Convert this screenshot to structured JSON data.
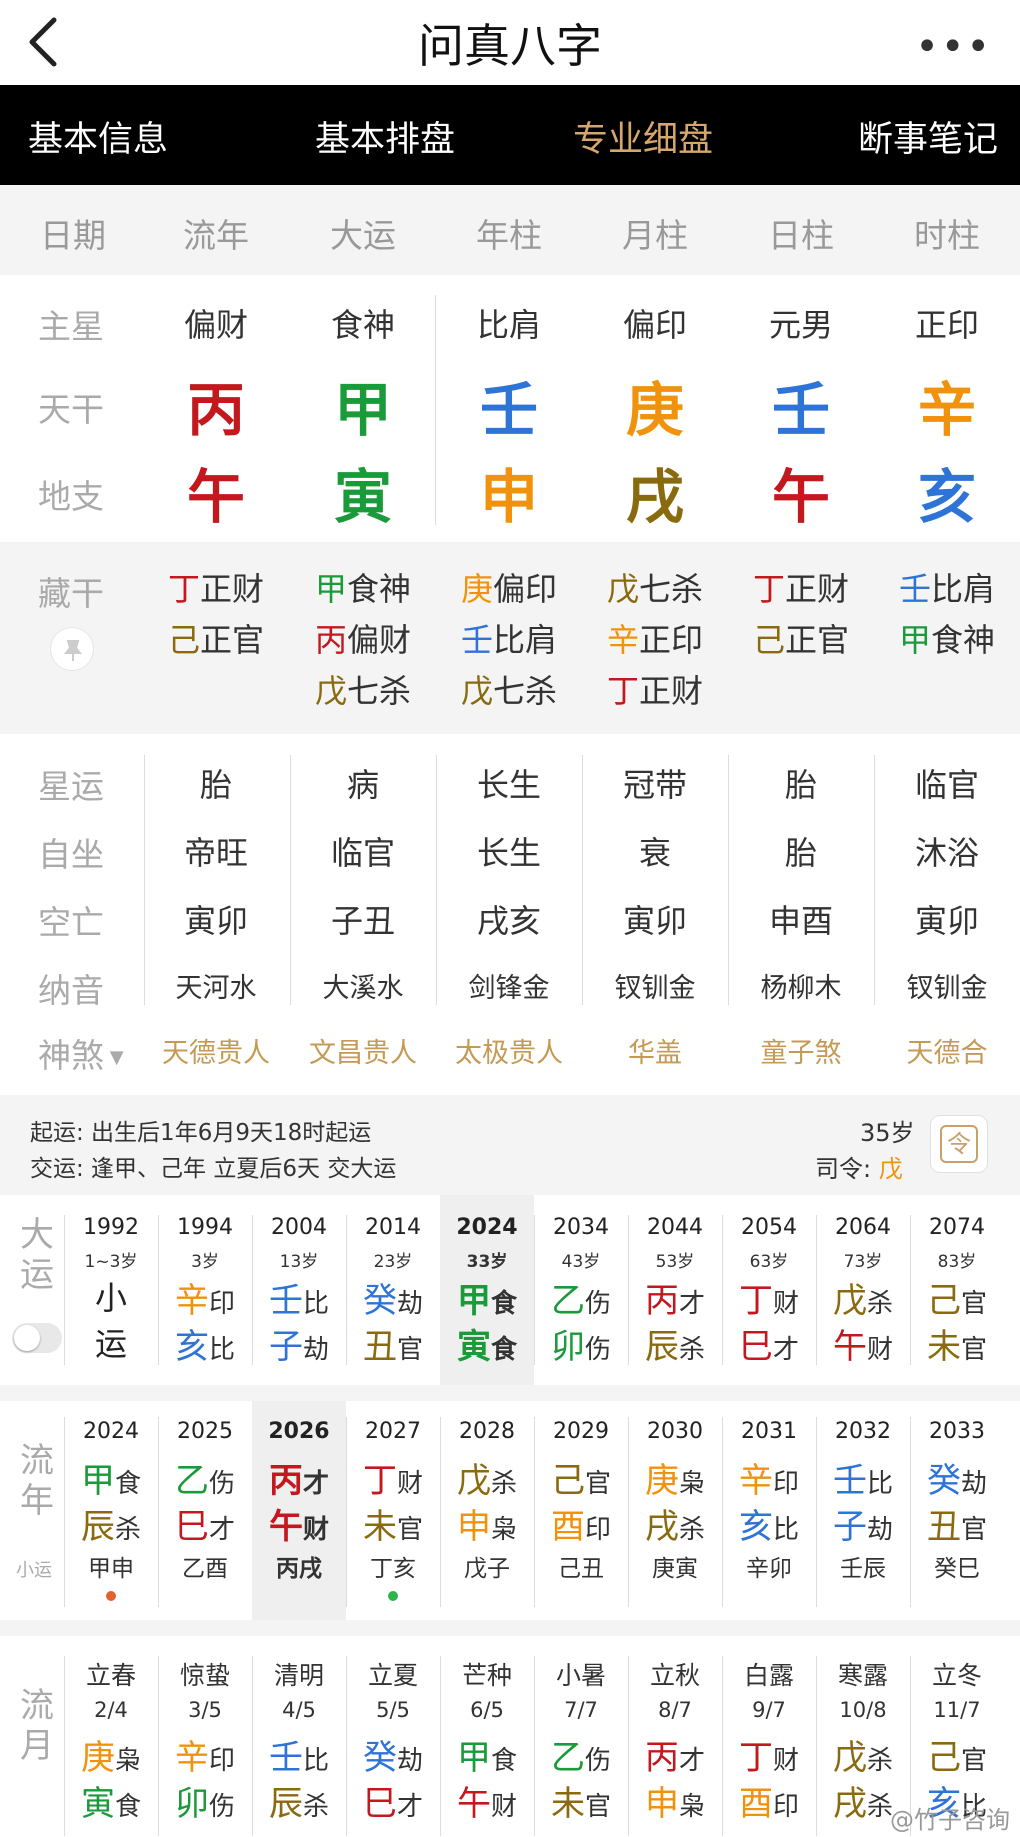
{
  "nav": {
    "title": "问真八字",
    "more": "•••"
  },
  "tabs": [
    "基本信息",
    "基本排盘",
    "专业细盘",
    "断事笔记"
  ],
  "columns": [
    "日期",
    "流年",
    "大运",
    "年柱",
    "月柱",
    "日柱",
    "时柱"
  ],
  "colors": {
    "fire": "#c3181e",
    "wood": "#1a9a38",
    "water": "#2e73d6",
    "metal": "#f0920c",
    "earth": "#8a6a0e",
    "accent": "#d6a76c"
  },
  "pillars": {
    "labels": {
      "main": "主星",
      "stem": "天干",
      "branch": "地支",
      "hidden": "藏干"
    },
    "main": [
      "偏财",
      "食神",
      "比肩",
      "偏印",
      "元男",
      "正印"
    ],
    "stems": [
      "丙",
      "甲",
      "壬",
      "庚",
      "壬",
      "辛"
    ],
    "branches": [
      "午",
      "寅",
      "申",
      "戌",
      "午",
      "亥"
    ],
    "hidden": [
      [
        [
          "丁",
          "正财"
        ],
        [
          "己",
          "正官"
        ]
      ],
      [
        [
          "甲",
          "食神"
        ],
        [
          "丙",
          "偏财"
        ],
        [
          "戊",
          "七杀"
        ]
      ],
      [
        [
          "庚",
          "偏印"
        ],
        [
          "壬",
          "比肩"
        ],
        [
          "戊",
          "七杀"
        ]
      ],
      [
        [
          "戊",
          "七杀"
        ],
        [
          "辛",
          "正印"
        ],
        [
          "丁",
          "正财"
        ]
      ],
      [
        [
          "丁",
          "正财"
        ],
        [
          "己",
          "正官"
        ]
      ],
      [
        [
          "壬",
          "比肩"
        ],
        [
          "甲",
          "食神"
        ]
      ]
    ]
  },
  "info": {
    "labels": {
      "xy": "星运",
      "zz": "自坐",
      "kw": "空亡",
      "ny": "纳音",
      "ss": "神煞"
    },
    "xingyun": [
      "胎",
      "病",
      "长生",
      "冠带",
      "胎",
      "临官"
    ],
    "zizuo": [
      "帝旺",
      "临官",
      "长生",
      "衰",
      "胎",
      "沐浴"
    ],
    "kongwang": [
      "寅卯",
      "子丑",
      "戌亥",
      "寅卯",
      "申酉",
      "寅卯"
    ],
    "nayin": [
      "天河水",
      "大溪水",
      "剑锋金",
      "钗钏金",
      "杨柳木",
      "钗钏金"
    ],
    "shensha": [
      "天德贵人",
      "文昌贵人",
      "太极贵人",
      "华盖",
      "童子煞",
      "天德合"
    ]
  },
  "luck": {
    "qiyun": "起运:  出生后1年6月9天18时起运",
    "jiaoyun": "交运:  逢甲、己年 立夏后6天 交大运",
    "age": "35岁",
    "siling": "司令:",
    "siling_val": "戊",
    "btn": "令"
  },
  "dayun": {
    "label1": "大",
    "label2": "运",
    "items": [
      {
        "year": "1992",
        "age": "1~3岁",
        "top": "小",
        "bot": "运"
      },
      {
        "year": "1994",
        "age": "3岁",
        "s": "辛",
        "sg": "印",
        "b": "亥",
        "bg": "比"
      },
      {
        "year": "2004",
        "age": "13岁",
        "s": "壬",
        "sg": "比",
        "b": "子",
        "bg": "劫"
      },
      {
        "year": "2014",
        "age": "23岁",
        "s": "癸",
        "sg": "劫",
        "b": "丑",
        "bg": "官"
      },
      {
        "year": "2024",
        "age": "33岁",
        "s": "甲",
        "sg": "食",
        "b": "寅",
        "bg": "食"
      },
      {
        "year": "2034",
        "age": "43岁",
        "s": "乙",
        "sg": "伤",
        "b": "卯",
        "bg": "伤"
      },
      {
        "year": "2044",
        "age": "53岁",
        "s": "丙",
        "sg": "才",
        "b": "辰",
        "bg": "杀"
      },
      {
        "year": "2054",
        "age": "63岁",
        "s": "丁",
        "sg": "财",
        "b": "巳",
        "bg": "才"
      },
      {
        "year": "2064",
        "age": "73岁",
        "s": "戊",
        "sg": "杀",
        "b": "午",
        "bg": "财"
      },
      {
        "year": "2074",
        "age": "83岁",
        "s": "己",
        "sg": "官",
        "b": "未",
        "bg": "官"
      }
    ]
  },
  "liunian": {
    "label1": "流",
    "label2": "年",
    "label3": "小运",
    "items": [
      {
        "year": "2024",
        "s": "甲",
        "sg": "食",
        "b": "辰",
        "bg": "杀",
        "x": "甲申"
      },
      {
        "year": "2025",
        "s": "乙",
        "sg": "伤",
        "b": "巳",
        "bg": "才",
        "x": "乙酉"
      },
      {
        "year": "2026",
        "s": "丙",
        "sg": "才",
        "b": "午",
        "bg": "财",
        "x": "丙戌"
      },
      {
        "year": "2027",
        "s": "丁",
        "sg": "财",
        "b": "未",
        "bg": "官",
        "x": "丁亥"
      },
      {
        "year": "2028",
        "s": "戊",
        "sg": "杀",
        "b": "申",
        "bg": "枭",
        "x": "戊子"
      },
      {
        "year": "2029",
        "s": "己",
        "sg": "官",
        "b": "酉",
        "bg": "印",
        "x": "己丑"
      },
      {
        "year": "2030",
        "s": "庚",
        "sg": "枭",
        "b": "戌",
        "bg": "杀",
        "x": "庚寅"
      },
      {
        "year": "2031",
        "s": "辛",
        "sg": "印",
        "b": "亥",
        "bg": "比",
        "x": "辛卯"
      },
      {
        "year": "2032",
        "s": "壬",
        "sg": "比",
        "b": "子",
        "bg": "劫",
        "x": "壬辰"
      },
      {
        "year": "2033",
        "s": "癸",
        "sg": "劫",
        "b": "丑",
        "bg": "官",
        "x": "癸巳"
      }
    ]
  },
  "liuyue": {
    "label1": "流",
    "label2": "月",
    "items": [
      {
        "term": "立春",
        "date": "2/4",
        "s": "庚",
        "sg": "枭",
        "b": "寅",
        "bg": "食"
      },
      {
        "term": "惊蛰",
        "date": "3/5",
        "s": "辛",
        "sg": "印",
        "b": "卯",
        "bg": "伤"
      },
      {
        "term": "清明",
        "date": "4/5",
        "s": "壬",
        "sg": "比",
        "b": "辰",
        "bg": "杀"
      },
      {
        "term": "立夏",
        "date": "5/5",
        "s": "癸",
        "sg": "劫",
        "b": "巳",
        "bg": "才"
      },
      {
        "term": "芒种",
        "date": "6/5",
        "s": "甲",
        "sg": "食",
        "b": "午",
        "bg": "财"
      },
      {
        "term": "小暑",
        "date": "7/7",
        "s": "乙",
        "sg": "伤",
        "b": "未",
        "bg": "官"
      },
      {
        "term": "立秋",
        "date": "8/7",
        "s": "丙",
        "sg": "才",
        "b": "申",
        "bg": "枭"
      },
      {
        "term": "白露",
        "date": "9/7",
        "s": "丁",
        "sg": "财",
        "b": "酉",
        "bg": "印"
      },
      {
        "term": "寒露",
        "date": "10/8",
        "s": "戊",
        "sg": "杀",
        "b": "戌",
        "bg": "杀"
      },
      {
        "term": "立冬",
        "date": "11/7",
        "s": "己",
        "sg": "官",
        "b": "亥",
        "bg": "比"
      }
    ]
  },
  "watermark": "@竹子咨询"
}
